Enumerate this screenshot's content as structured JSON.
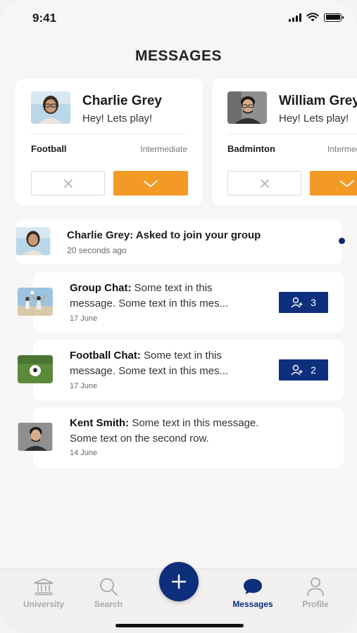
{
  "status": {
    "time": "9:41"
  },
  "page_title": "MESSAGES",
  "requests": [
    {
      "name": "Charlie Grey",
      "message": "Hey! Lets play!",
      "sport": "Football",
      "level": "Intermediate"
    },
    {
      "name": "William Grey",
      "message": "Hey! Lets play!",
      "sport": "Badminton",
      "level": "Intermediate"
    }
  ],
  "notification": {
    "title": "Charlie Grey: Asked to join your group",
    "time": "20 seconds ago",
    "unread": true
  },
  "chats": [
    {
      "title": "Group Chat:",
      "line1": " Some text in this",
      "line2": "message. Some text in this mes...",
      "date": "17 June",
      "member_count": "3"
    },
    {
      "title": "Football Chat:",
      "line1": " Some text in this",
      "line2": "message. Some text in this mes...",
      "date": "17 June",
      "member_count": "2"
    },
    {
      "title": "Kent Smith:",
      "line1": " Some text in this message.",
      "line2": "Some text on the second row.",
      "date": "14 June"
    }
  ],
  "tabs": [
    {
      "label": "University",
      "icon": "university-icon"
    },
    {
      "label": "Search",
      "icon": "search-icon"
    },
    {
      "label": "Messages",
      "icon": "chat-bubble-icon",
      "active": true
    },
    {
      "label": "Profile",
      "icon": "profile-icon"
    }
  ],
  "colors": {
    "accent_orange": "#f39a26",
    "brand_navy": "#0e2f7c",
    "background": "#f7f6f5"
  }
}
